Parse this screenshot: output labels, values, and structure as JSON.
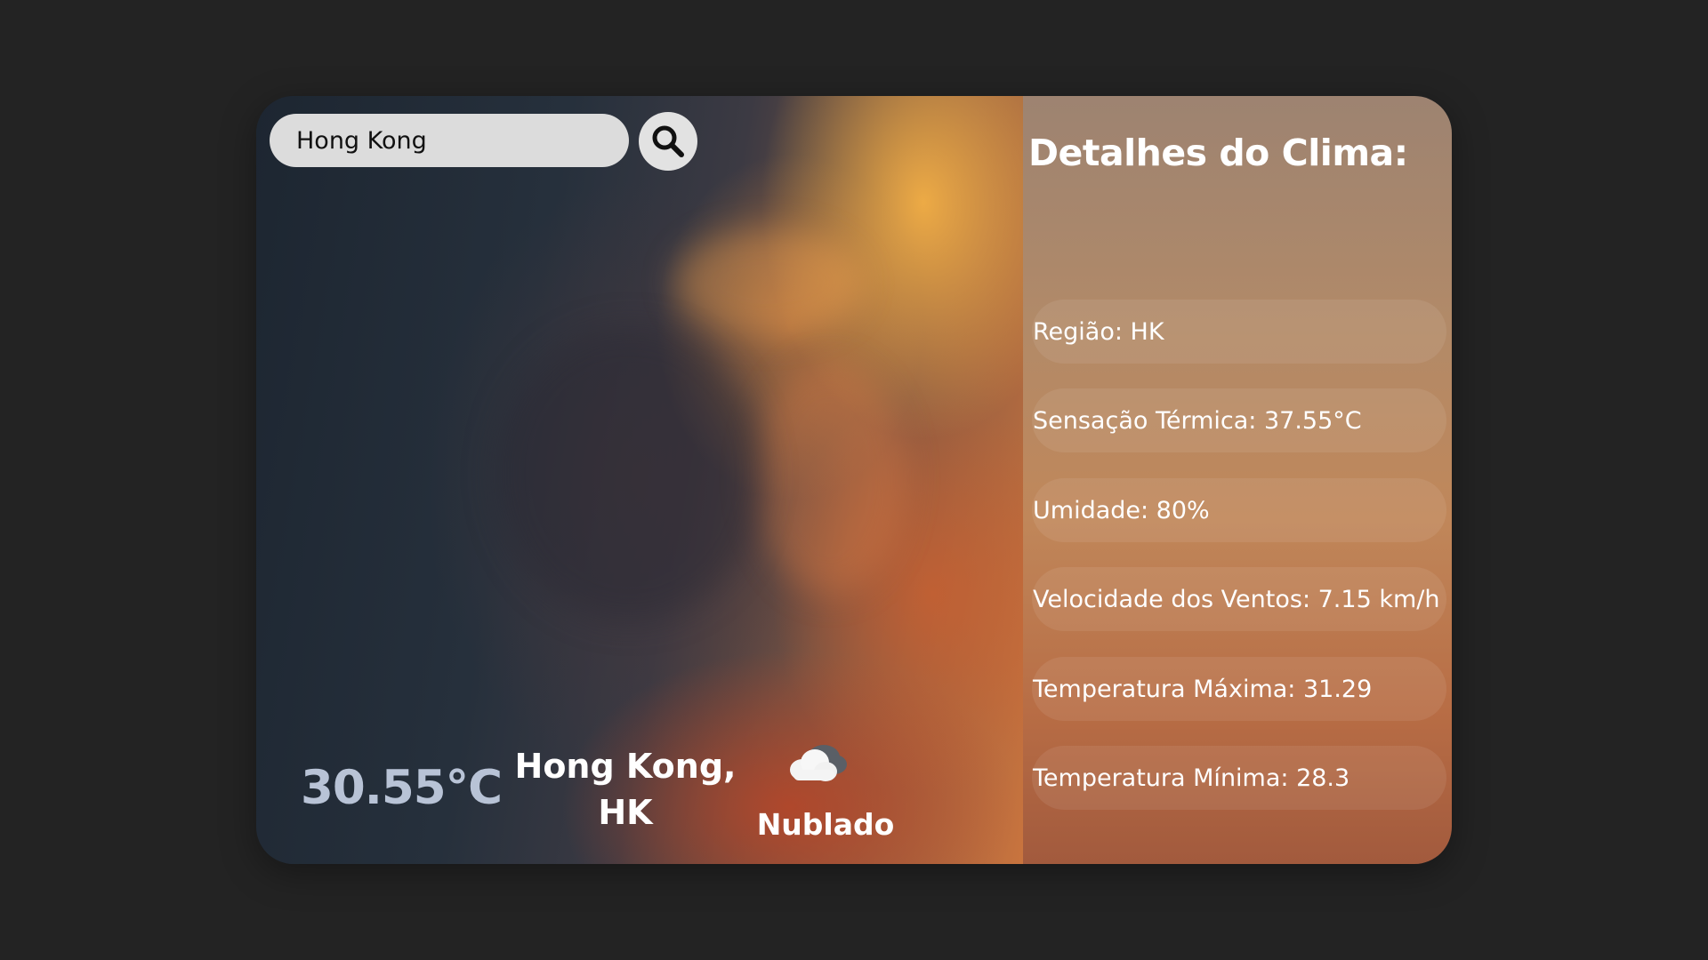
{
  "search": {
    "value": "Hong Kong",
    "button_icon": "search-icon"
  },
  "current": {
    "temperature": "30.55°C",
    "city": "Hong Kong, HK",
    "condition": "Nublado",
    "condition_icon": "cloud-icon"
  },
  "details": {
    "title": "Detalhes do Clima:",
    "items": [
      "Região: HK",
      "Sensação Térmica: 37.55°C",
      "Umidade: 80%",
      "Velocidade dos Ventos: 7.15 km/h",
      "Temperatura Máxima: 31.29",
      "Temperatura Mínima: 28.3"
    ]
  }
}
